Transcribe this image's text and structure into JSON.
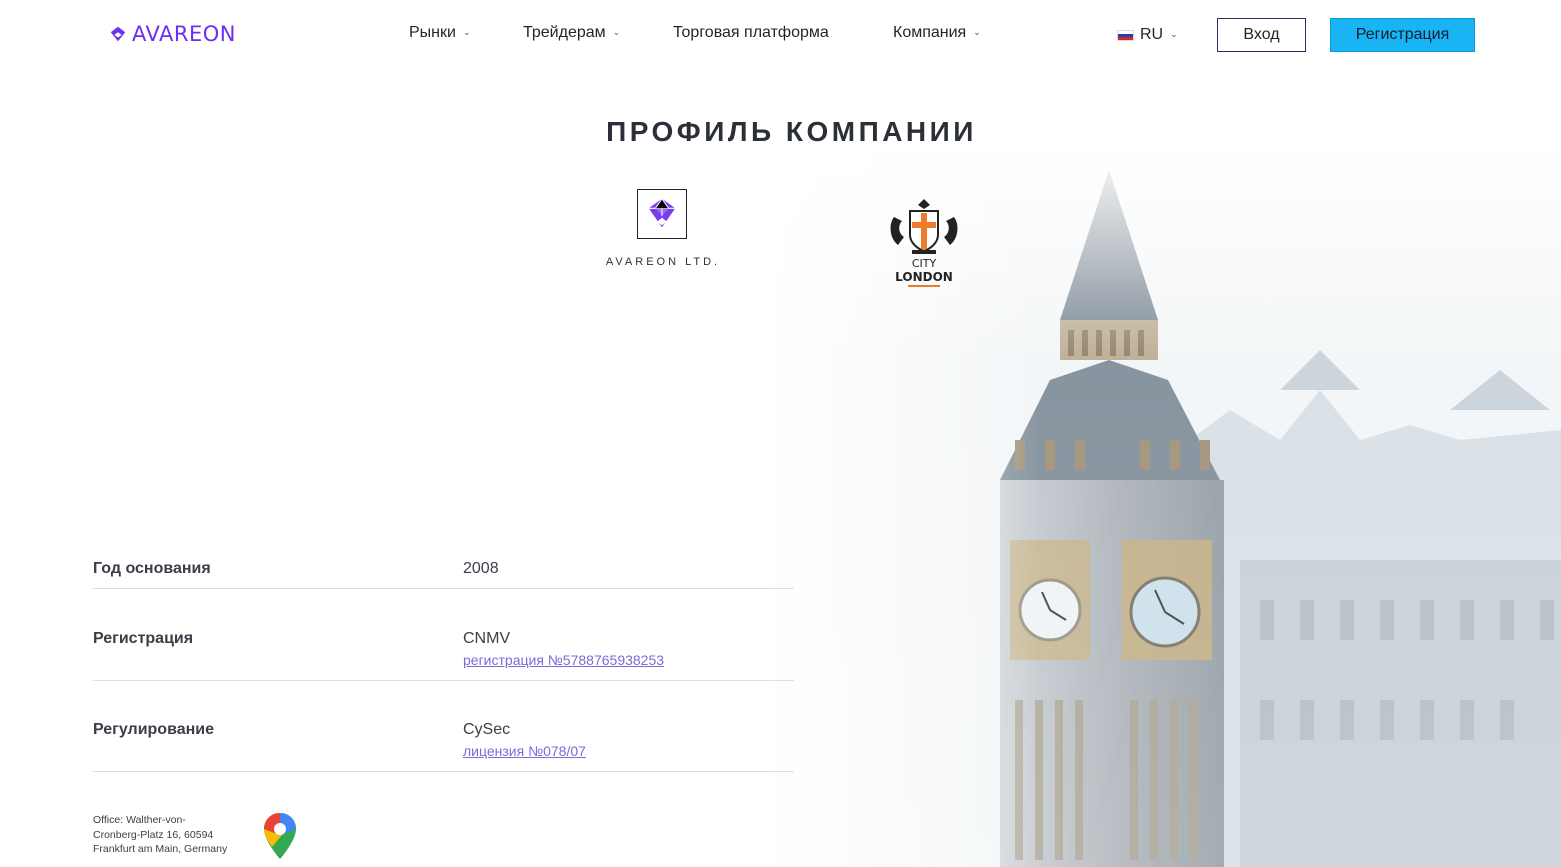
{
  "brand": {
    "name": "AVAREON",
    "accent": "#6d2ef2",
    "company_caption": "AVAREON LTD."
  },
  "nav": {
    "items": [
      {
        "label": "Рынки",
        "dropdown": true
      },
      {
        "label": "Трейдерам",
        "dropdown": true
      },
      {
        "label": "Торговая платформа",
        "dropdown": false
      },
      {
        "label": "Компания",
        "dropdown": true
      }
    ],
    "chevron_icon": "chevron-down-icon"
  },
  "language": {
    "current": "RU",
    "flag": "russia-flag-icon"
  },
  "auth": {
    "login_label": "Вход",
    "register_label": "Регистрация",
    "register_color": "#19b4f4"
  },
  "page": {
    "title": "ПРОФИЛЬ КОМПАНИИ"
  },
  "crest": {
    "line1": "CITY",
    "line2": "LONDON"
  },
  "profile": {
    "founded": {
      "label": "Год основания",
      "value": "2008"
    },
    "registration": {
      "label": "Регистрация",
      "value": "CNMV",
      "link": "регистрация №5788765938253"
    },
    "regulation": {
      "label": "Регулирование",
      "value": "CySec",
      "link": "лицензия №078/07"
    }
  },
  "footer": {
    "address_line1": "Office: Walther-von-",
    "address_line2": "Cronberg-Platz 16, 60594",
    "address_line3": "Frankfurt am Main, Germany",
    "map_icon": "google-maps-pin-icon"
  }
}
